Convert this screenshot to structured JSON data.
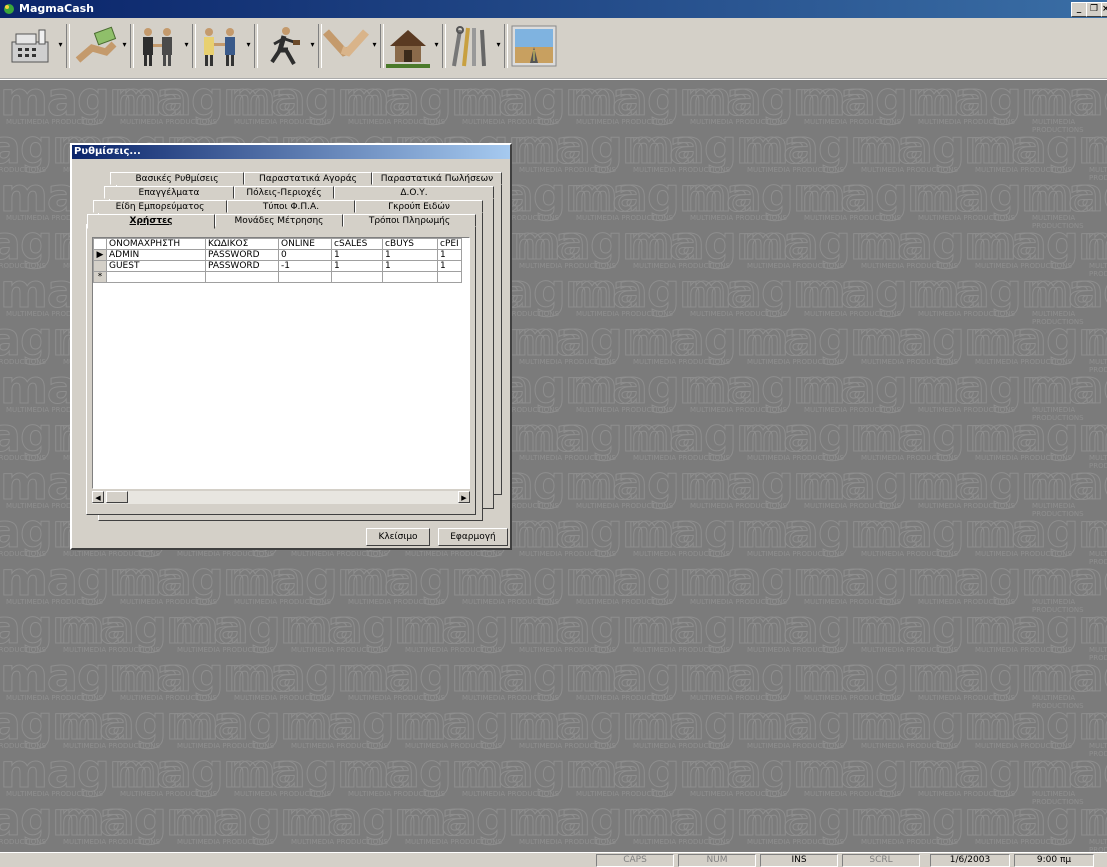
{
  "window": {
    "title": "MagmaCash"
  },
  "desktop": {
    "watermark_main": "magma",
    "watermark_sub": "MULTIMEDIA PRODUCTIONS"
  },
  "dialog": {
    "title": "Ρυθμίσεις...",
    "tabs_row1": [
      "Βασικές Ρυθμίσεις",
      "Παραστατικά Αγοράς",
      "Παραστατικά Πωλήσεων"
    ],
    "tabs_row2": [
      "Επαγγέλματα",
      "Πόλεις-Περιοχές",
      "Δ.Ο.Υ."
    ],
    "tabs_row3": [
      "Είδη Εμπορεύματος",
      "Τύποι Φ.Π.Α.",
      "Γκρούπ Ειδών"
    ],
    "tabs_row4": [
      "Χρήστες",
      "Μονάδες Μέτρησης",
      "Τρόποι Πληρωμής"
    ],
    "grid": {
      "columns": [
        "ΟΝΟΜΑΧΡΗΣΤΗ",
        "ΚΩΔΙΚΟΣ",
        "ONLINE",
        "cSALES",
        "cBUYS",
        "cPEI"
      ],
      "rows": [
        [
          "ADMIN",
          "PASSWORD",
          "0",
          "1",
          "1",
          "1"
        ],
        [
          "GUEST",
          "PASSWORD",
          "-1",
          "1",
          "1",
          "1"
        ]
      ],
      "current_row_marker": "▶",
      "new_row_marker": "*"
    },
    "buttons": {
      "close": "Κλείσιμο",
      "apply": "Εφαρμογή"
    }
  },
  "statusbar": {
    "caps": "CAPS",
    "num": "NUM",
    "ins": "INS",
    "scrl": "SCRL",
    "date": "1/6/2003",
    "time": "9:00 πμ"
  },
  "toolbar_icons": [
    "cash-register-icon",
    "money-hand-icon",
    "business-people-icon",
    "handshake-men-icon",
    "running-man-icon",
    "handshake-icon",
    "house-icon",
    "tools-icon",
    "road-landscape-icon"
  ]
}
